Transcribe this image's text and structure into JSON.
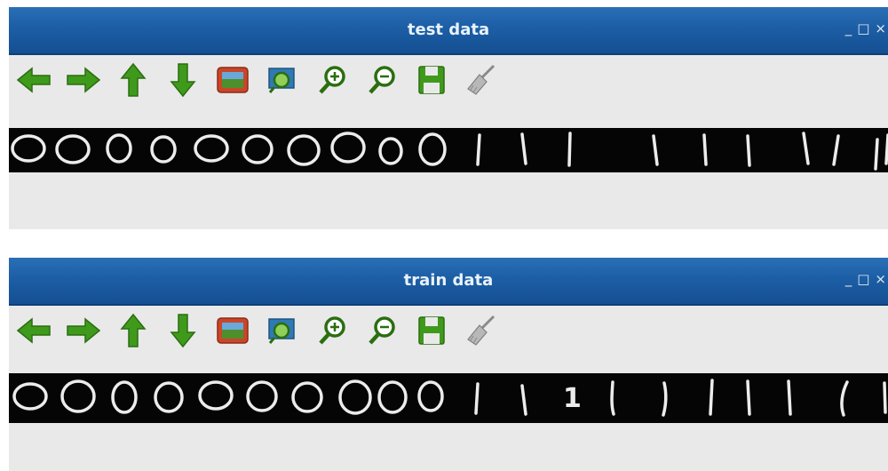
{
  "windows": {
    "test": {
      "title": "test data",
      "controls": {
        "minimize": "_",
        "maximize": "□",
        "close": "×"
      }
    },
    "train": {
      "title": "train data",
      "controls": {
        "minimize": "_",
        "maximize": "□",
        "close": "×"
      }
    }
  },
  "toolbar": {
    "icons": [
      "arrow-left-icon",
      "arrow-right-icon",
      "arrow-up-icon",
      "arrow-down-icon",
      "image-icon",
      "zoom-fit-icon",
      "zoom-in-icon",
      "zoom-out-icon",
      "save-icon",
      "broom-icon"
    ]
  },
  "strips": {
    "test": {
      "zeros": 10,
      "ones": 10
    },
    "train": {
      "zeros": 10,
      "ones": 10,
      "printed_digit": "1"
    }
  },
  "colors": {
    "titlebar": "#1c5ea5",
    "icon_green": "#3f9a1c",
    "window_bg": "#e9e9e9",
    "strip_bg": "#050505"
  }
}
